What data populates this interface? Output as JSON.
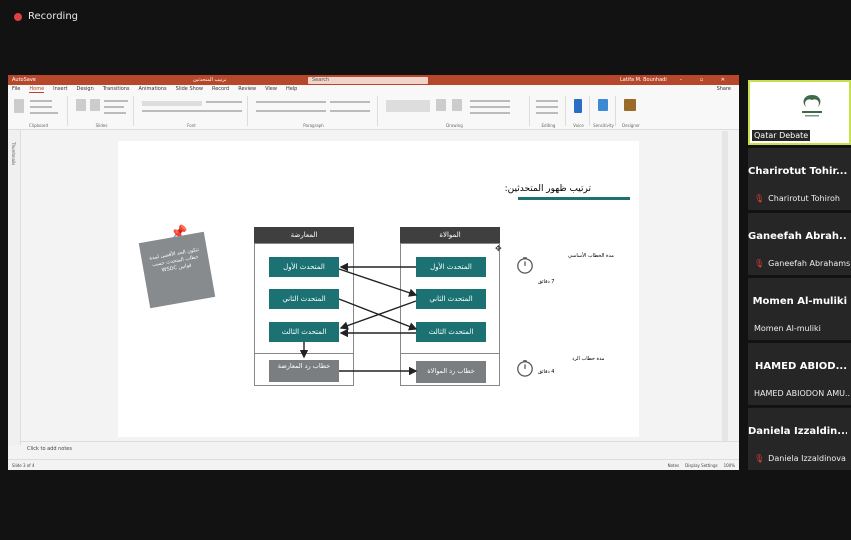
{
  "recording": {
    "label": "Recording"
  },
  "ppt": {
    "titlebar": {
      "autosave": "AutoSave",
      "doc": "ترتيب المتحدثين",
      "search": "Search",
      "user": "Latifa M. Bounhadi",
      "controls": "– ▫ ✕"
    },
    "menu": [
      "File",
      "Home",
      "Insert",
      "Design",
      "Transitions",
      "Animations",
      "Slide Show",
      "Record",
      "Review",
      "View",
      "Help"
    ],
    "menu_active": "Home",
    "share": "Share",
    "groups": [
      "Clipboard",
      "Slides",
      "Font",
      "Paragraph",
      "Drawing",
      "Editing",
      "Voice",
      "Sensitivity",
      "Designer"
    ],
    "sidebar_label": "Thumbnails",
    "notes": "Click to add notes",
    "status_left": "Slide 3 of 4",
    "status_right": [
      "Notes",
      "Display Settings",
      "100%"
    ]
  },
  "slide": {
    "title": "ترتيب ظهور المتحدثين:",
    "col_left_head": "المعارضة",
    "col_right_head": "الموالاة",
    "opp": [
      "المتحدث الأول",
      "المتحدث الثاني",
      "المتحدث الثالث"
    ],
    "prop": [
      "المتحدث الأول",
      "المتحدث الثاني",
      "المتحدث الثالث"
    ],
    "opp_reply": "خطاب رد المعارضة",
    "prop_reply": "خطاب رد الموالاة",
    "timer1_label": "مدة الخطاب الأساسي",
    "timer1_value": "7 دقائق",
    "timer2_label": "مدة خطاب الرد",
    "timer2_value": "4 دقائق",
    "note": "تتكون الحد الأقصى لمدة خطاب المتحدث حسب قوانين WSDC"
  },
  "participants": [
    {
      "name": "Qatar Debate",
      "label": "Qatar Debate",
      "muted": false,
      "logo": true
    },
    {
      "name": "Charirotut Tohir...",
      "label": "Charirotut Tohiroh",
      "muted": true
    },
    {
      "name": "Ganeefah Abrah...",
      "label": "Ganeefah Abrahams",
      "muted": true
    },
    {
      "name": "Momen Al-muliki",
      "label": "Momen Al-muliki",
      "muted": false
    },
    {
      "name": "HAMED ABIOD...",
      "label": "HAMED ABIODON AMU...",
      "muted": false
    },
    {
      "name": "Daniela Izzaldin...",
      "label": "Daniela Izzaldinova",
      "muted": true
    }
  ],
  "colors": {
    "teal": "#1c7173",
    "ppt_red": "#b7472a",
    "tile_bg": "#262626",
    "highlight": "#c6e04a"
  }
}
